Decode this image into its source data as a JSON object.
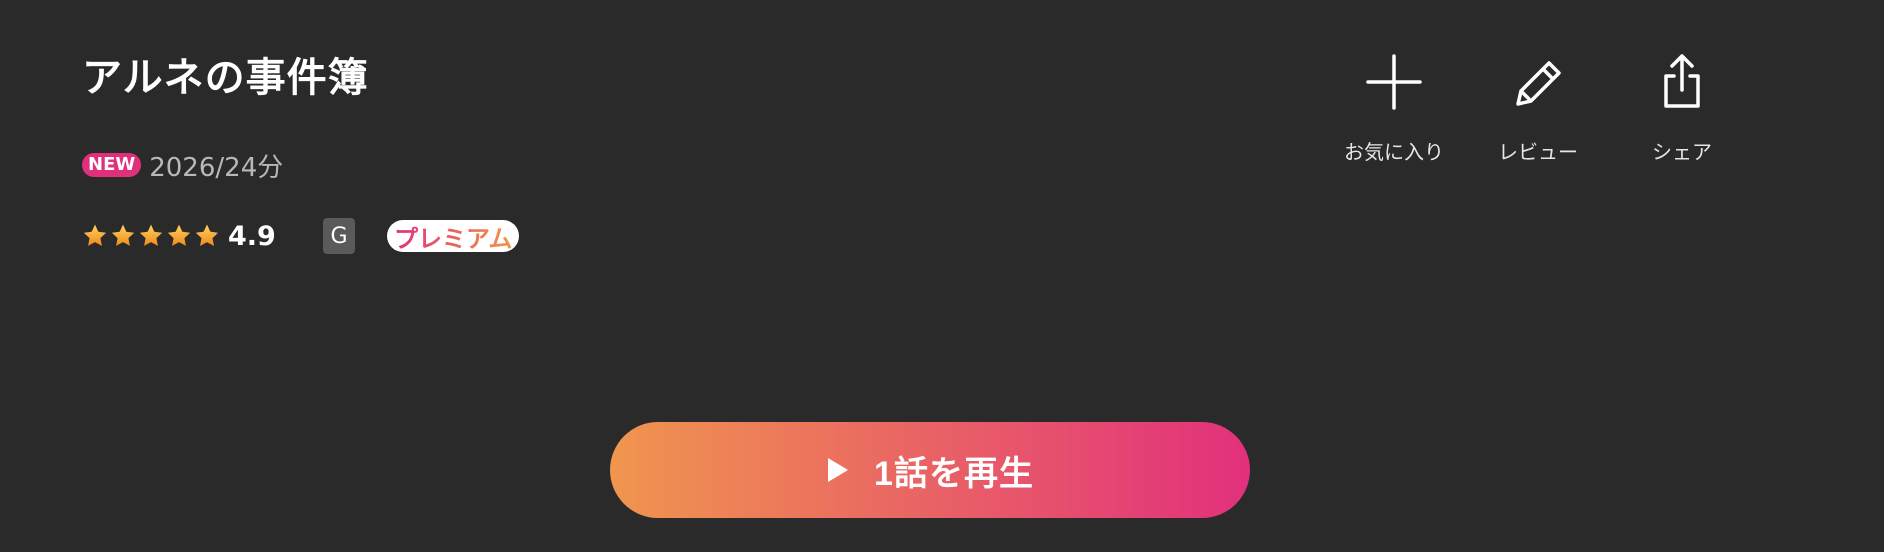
{
  "title": "アルネの事件簿",
  "meta": {
    "new_badge": "NEW",
    "year_duration": "2026/24分"
  },
  "rating": {
    "stars": 4.9,
    "value": "4.9",
    "star_icons": [
      "star-icon",
      "star-icon",
      "star-icon",
      "star-icon",
      "star-icon"
    ],
    "star_color": "#f6a623"
  },
  "age_rating": "G",
  "premium_label": "プレミアム",
  "actions": {
    "favorite": {
      "label": "お気に入り",
      "icon": "plus-icon"
    },
    "review": {
      "label": "レビュー",
      "icon": "pencil-icon"
    },
    "share": {
      "label": "シェア",
      "icon": "share-icon"
    }
  },
  "play": {
    "label": "1話を再生",
    "icon": "play-icon"
  },
  "colors": {
    "background": "#2a2a2a",
    "accent_start": "#f0954e",
    "accent_end": "#e2307c",
    "new_badge": "#e0307c"
  }
}
